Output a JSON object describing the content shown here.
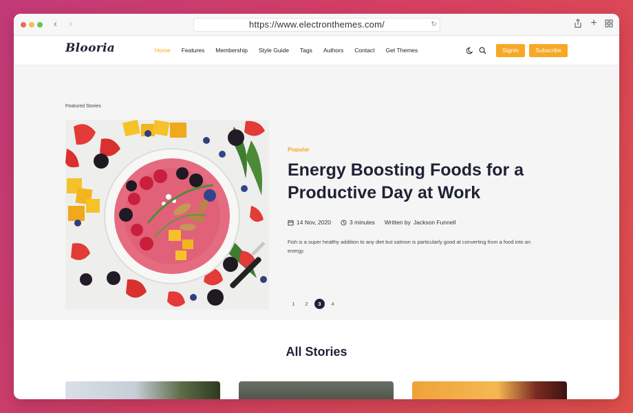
{
  "browser": {
    "url": "https://www.electronthemes.com/"
  },
  "site": {
    "logo": "Blooria",
    "nav": [
      {
        "label": "Home",
        "active": true
      },
      {
        "label": "Features"
      },
      {
        "label": "Membership"
      },
      {
        "label": "Style Guide"
      },
      {
        "label": "Tags"
      },
      {
        "label": "Authors"
      },
      {
        "label": "Contact"
      },
      {
        "label": "Get Themes"
      }
    ],
    "signin_label": "Signin",
    "subscribe_label": "Subscribe",
    "accent_color": "#f5a623"
  },
  "featured": {
    "section_label": "Featured Stories",
    "tag": "Popular",
    "title": "Energy Boosting Foods for a Productive Day at Work",
    "date": "14 Nov, 2020",
    "read_time": "3 minutes",
    "written_by_label": "Written by",
    "author": "Jackson Funnell",
    "excerpt": "Fish is a super healthy addition to any diet but salmon is particularly good at converting from a food into an energy.",
    "pages": [
      "1",
      "2",
      "3",
      "4"
    ],
    "current_page": "3"
  },
  "all_stories": {
    "title": "All Stories"
  }
}
